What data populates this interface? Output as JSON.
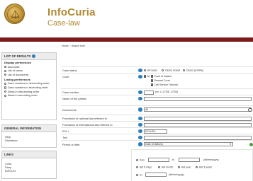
{
  "header": {
    "brand": "InfoCuria",
    "subtitle": "Case-law"
  },
  "breadcrumb": {
    "home": "Home",
    "separator": ">",
    "current": "Search form"
  },
  "sidebar": {
    "results": {
      "title": "LIST OF RESULTS",
      "display_heading": "Display preferences",
      "display_options": [
        "Automatic",
        "List of cases",
        "List of documents"
      ],
      "listing_heading": "Listing preferences",
      "listing_options": [
        "Case numbers in descending order",
        "Case numbers in ascending order",
        "Dates in descending order",
        "Dates in ascending order"
      ]
    },
    "general": {
      "title": "GENERAL INFORMATION",
      "links": [
        "Help",
        "Disclaimer"
      ]
    },
    "links": {
      "title": "LINKS",
      "items": [
        "Curia",
        "Diary",
        "EUR-Lex"
      ]
    }
  },
  "form": {
    "case_status": {
      "label": "Case status",
      "options": [
        "All cases",
        "Cases closed",
        "Cases pending"
      ]
    },
    "court": {
      "label": "Court",
      "all": "All",
      "options": [
        "Court of Justice",
        "General Court",
        "Civil Service Tribunal"
      ]
    },
    "case_number": {
      "label": "Case number",
      "hint": "(ex: C-17/05, 17/05)"
    },
    "parties": {
      "label": "Name of the parties"
    },
    "documents": {
      "label": "Documents",
      "value": "All"
    },
    "national_law": {
      "label": "Provisions of national law referred to"
    },
    "international_law": {
      "label": "Provisions of international law referred to"
    },
    "ecli": {
      "label": "ECLI",
      "value": "ECLI:EU:"
    },
    "text": {
      "label": "Text"
    },
    "period": {
      "label": "Period or date",
      "select_value": "Date of delivery",
      "from_label": "from",
      "to_label": "to",
      "date_format": "(dd/mm/yyyy)",
      "ranges": [
        "last 8 days",
        "last month",
        "last year",
        "last 3 years"
      ],
      "on_label": "on",
      "on_format": "(dd/mm/yyyy)"
    }
  }
}
